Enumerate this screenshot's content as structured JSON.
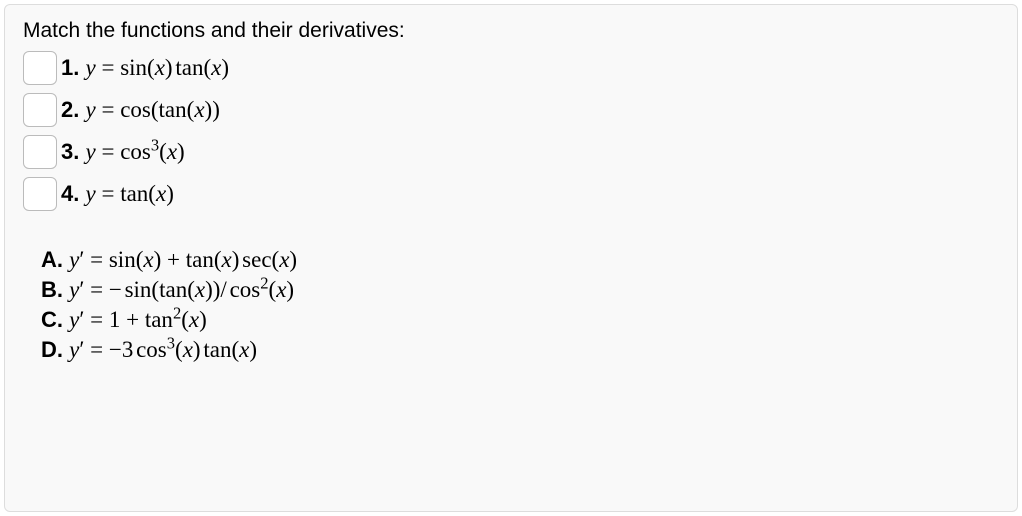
{
  "prompt": "Match the functions and their derivatives:",
  "items": [
    {
      "num": "1.",
      "expr_html": "<span class='mi'>y</span> = <span class='fn'>sin</span>(<span class='mi'>x</span>)<span class='thin'></span><span class='fn'>tan</span>(<span class='mi'>x</span>)"
    },
    {
      "num": "2.",
      "expr_html": "<span class='mi'>y</span> = <span class='fn'>cos</span>(<span class='fn'>tan</span>(<span class='mi'>x</span>))"
    },
    {
      "num": "3.",
      "expr_html": "<span class='mi'>y</span> = <span class='fn'>cos</span><sup>3</sup>(<span class='mi'>x</span>)"
    },
    {
      "num": "4.",
      "expr_html": "<span class='mi'>y</span> = <span class='fn'>tan</span>(<span class='mi'>x</span>)"
    }
  ],
  "answers": [
    {
      "label": "A.",
      "expr_html": "<span class='mi'>y</span>&prime; = <span class='fn'>sin</span>(<span class='mi'>x</span>) + <span class='fn'>tan</span>(<span class='mi'>x</span>)<span class='thin'></span><span class='fn'>sec</span>(<span class='mi'>x</span>)"
    },
    {
      "label": "B.",
      "expr_html": "<span class='mi'>y</span>&prime; = &minus;<span class='thin'></span><span class='fn'>sin</span>(<span class='fn'>tan</span>(<span class='mi'>x</span>))/<span class='thin'></span><span class='fn'>cos</span><sup>2</sup>(<span class='mi'>x</span>)"
    },
    {
      "label": "C.",
      "expr_html": "<span class='mi'>y</span>&prime; = 1 + <span class='fn'>tan</span><sup>2</sup>(<span class='mi'>x</span>)"
    },
    {
      "label": "D.",
      "expr_html": "<span class='mi'>y</span>&prime; = &minus;3<span class='thin'></span><span class='fn'>cos</span><sup>3</sup>(<span class='mi'>x</span>)<span class='thin'></span><span class='fn'>tan</span>(<span class='mi'>x</span>)"
    }
  ]
}
